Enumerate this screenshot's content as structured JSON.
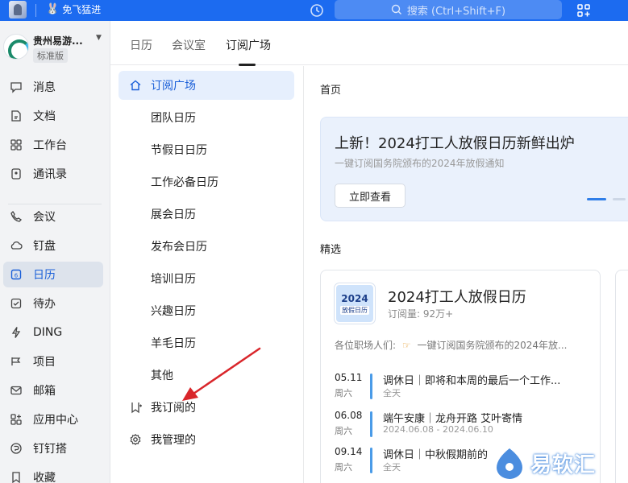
{
  "topbar": {
    "status_text": "免飞猛进",
    "search_placeholder": "搜索 (Ctrl+Shift+F)"
  },
  "org": {
    "name": "贵州易游...",
    "badge": "标准版"
  },
  "sidebar": {
    "items": [
      {
        "label": "消息",
        "icon": "message-icon"
      },
      {
        "label": "文档",
        "icon": "document-icon"
      },
      {
        "label": "工作台",
        "icon": "workbench-icon"
      },
      {
        "label": "通讯录",
        "icon": "contacts-icon"
      },
      {
        "label": "会议",
        "icon": "meeting-icon"
      },
      {
        "label": "钉盘",
        "icon": "cloud-drive-icon"
      },
      {
        "label": "日历",
        "icon": "calendar-icon",
        "active": true
      },
      {
        "label": "待办",
        "icon": "todo-icon"
      },
      {
        "label": "DING",
        "icon": "ding-icon"
      },
      {
        "label": "项目",
        "icon": "project-icon"
      },
      {
        "label": "邮箱",
        "icon": "mail-icon"
      },
      {
        "label": "应用中心",
        "icon": "app-center-icon"
      },
      {
        "label": "钉钉搭",
        "icon": "builder-icon"
      },
      {
        "label": "收藏",
        "icon": "favorite-icon"
      }
    ]
  },
  "tabs": [
    {
      "label": "日历"
    },
    {
      "label": "会议室"
    },
    {
      "label": "订阅广场",
      "active": true
    }
  ],
  "submenu": {
    "home": "订阅广场",
    "categories": [
      "团队日历",
      "节假日日历",
      "工作必备日历",
      "展会日历",
      "发布会日历",
      "培训日历",
      "兴趣日历",
      "羊毛日历",
      "其他"
    ],
    "mine": "我订阅的",
    "managed": "我管理的"
  },
  "main": {
    "breadcrumb": "首页",
    "banner": {
      "title": "上新！2024打工人放假日历新鲜出炉",
      "subtitle": "一键订阅国务院颁布的2024年放假通知",
      "button": "立即查看"
    },
    "section_title": "精选",
    "card": {
      "cover_year": "2024",
      "cover_text": "放假日历",
      "title": "2024打工人放假日历",
      "subscribers": "订阅量: 92万+",
      "intro_prefix": "各位职场人们:",
      "intro_text": "一键订阅国务院颁布的2024年放...",
      "events": [
        {
          "date": "05.11",
          "weekday": "周六",
          "title": "调休日｜即将和本周的最后一个工作...",
          "sub": "全天"
        },
        {
          "date": "06.08",
          "weekday": "周六",
          "title": "端午安康｜龙舟开路 艾叶寄情",
          "sub": "2024.06.08 - 2024.06.10"
        },
        {
          "date": "09.14",
          "weekday": "周六",
          "title": "调休日｜中秋假期前的",
          "sub": "全天"
        }
      ]
    }
  },
  "watermark": {
    "text": "易软汇"
  },
  "colors": {
    "brand": "#1c6bf0",
    "accent": "#1a5fd8",
    "annotation": "#d9262b"
  }
}
